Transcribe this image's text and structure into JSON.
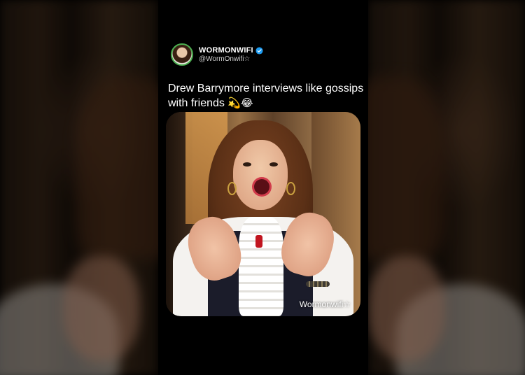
{
  "post": {
    "display_name": "WORMONWIFI",
    "username": "@WormOnwifi☆",
    "caption": "Drew Barrymore interviews like gossips with friends",
    "caption_emojis": "💫😂",
    "verified_icon": "verified-badge-icon"
  },
  "video": {
    "watermark": "Wormonwifi☆"
  },
  "colors": {
    "background": "#000000",
    "verified_blue": "#1d9bf0",
    "avatar_ring": "#4caf50",
    "text_primary": "#ffffff",
    "text_secondary": "#cfcfcf"
  }
}
